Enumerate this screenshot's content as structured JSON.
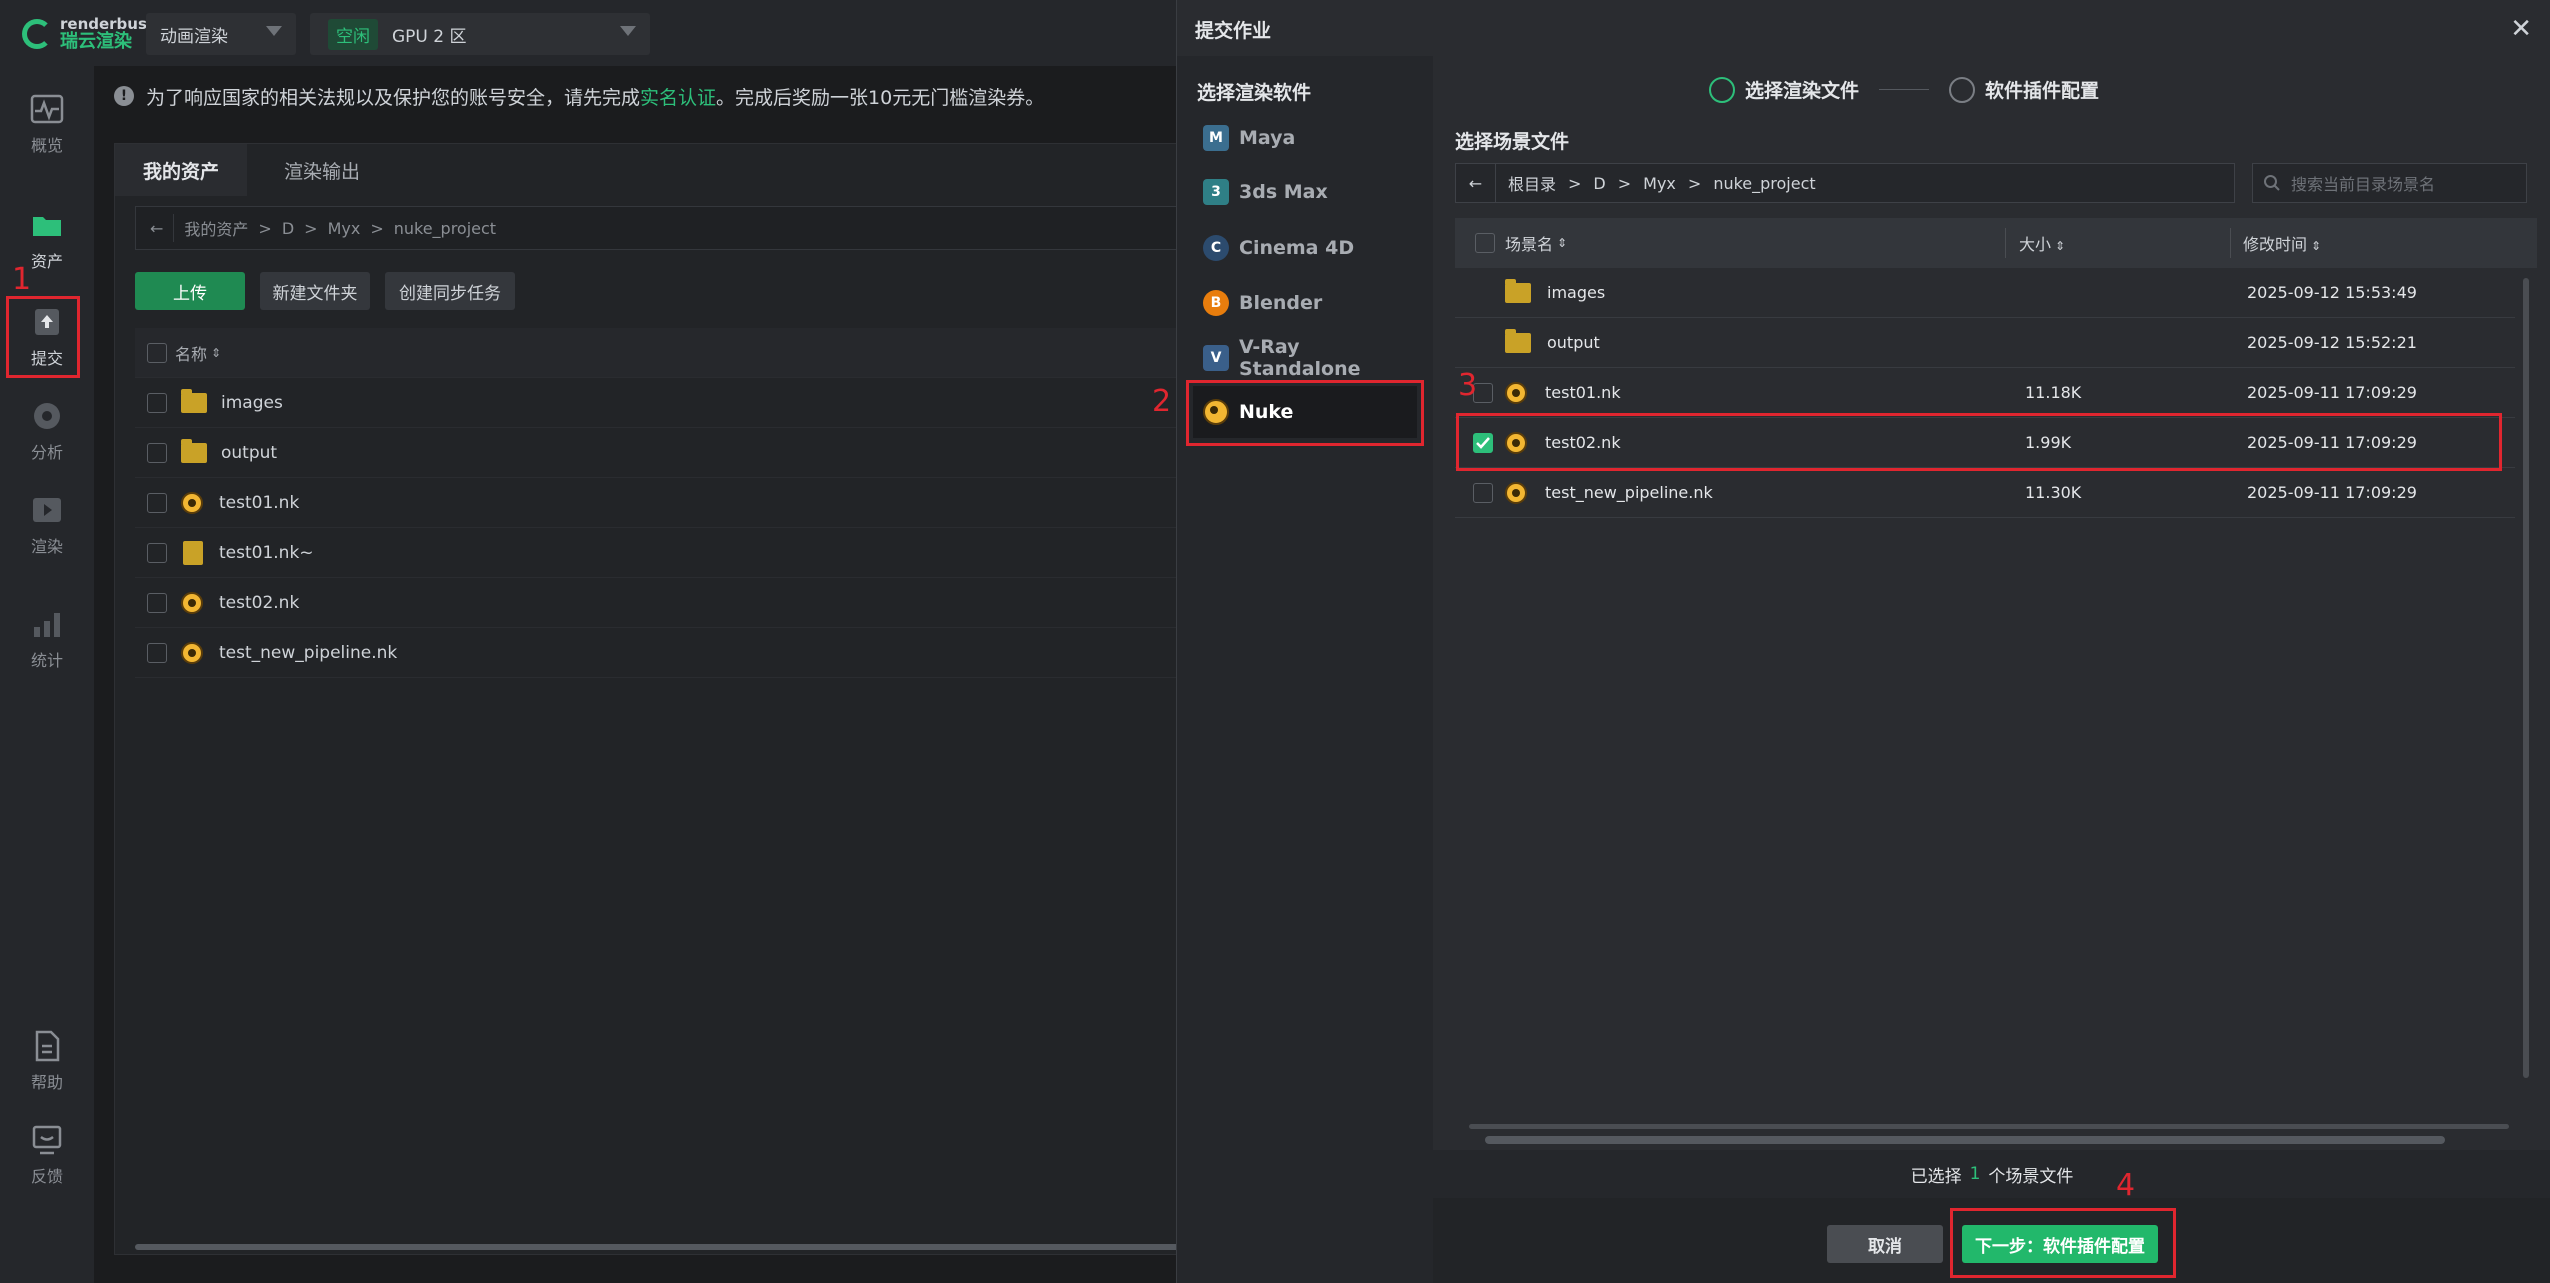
{
  "app": {
    "logo_brand": "renderbus",
    "logo_name": "瑞云渲染"
  },
  "topbar": {
    "mode_select": "动画渲染",
    "status_badge": "空闲",
    "gpu_select": "GPU 2 区"
  },
  "sidebar": {
    "items": [
      {
        "label": "概览",
        "icon": "pulse-icon"
      },
      {
        "label": "资产",
        "icon": "folder-icon"
      },
      {
        "label": "提交",
        "icon": "upload-icon"
      },
      {
        "label": "分析",
        "icon": "analysis-icon"
      },
      {
        "label": "渲染",
        "icon": "render-icon"
      },
      {
        "label": "统计",
        "icon": "bar-chart-icon"
      },
      {
        "label": "帮助",
        "icon": "doc-icon"
      },
      {
        "label": "反馈",
        "icon": "feedback-icon"
      }
    ]
  },
  "notice": {
    "prefix": "为了响应国家的相关法规以及保护您的账号安全，请先完成",
    "link": "实名认证",
    "suffix": "。完成后奖励一张10元无门槛渲染券。"
  },
  "assets": {
    "tabs": [
      "我的资产",
      "渲染输出"
    ],
    "path": [
      "我的资产",
      "D",
      "Myx",
      "nuke_project"
    ],
    "buttons": {
      "upload": "上传",
      "new_folder": "新建文件夹",
      "sync": "创建同步任务"
    },
    "col_name": "名称",
    "rows": [
      {
        "name": "images",
        "type": "folder"
      },
      {
        "name": "output",
        "type": "folder"
      },
      {
        "name": "test01.nk",
        "type": "nuke"
      },
      {
        "name": "test01.nk~",
        "type": "file"
      },
      {
        "name": "test02.nk",
        "type": "nuke"
      },
      {
        "name": "test_new_pipeline.nk",
        "type": "nuke"
      }
    ]
  },
  "dialog": {
    "title": "提交作业",
    "software_header": "选择渲染软件",
    "software": [
      "Maya",
      "3ds Max",
      "Cinema 4D",
      "Blender",
      "V-Ray Standalone",
      "Nuke"
    ],
    "step1": "选择渲染文件",
    "step2": "软件插件配置",
    "scene_header": "选择场景文件",
    "path": [
      "根目录",
      "D",
      "Myx",
      "nuke_project"
    ],
    "search_placeholder": "搜索当前目录场景名",
    "columns": {
      "name": "场景名",
      "size": "大小",
      "mtime": "修改时间"
    },
    "rows": [
      {
        "name": "images",
        "size": "",
        "mtime": "2025-09-12 15:53:49",
        "type": "folder",
        "checked": false
      },
      {
        "name": "output",
        "size": "",
        "mtime": "2025-09-12 15:52:21",
        "type": "folder",
        "checked": false
      },
      {
        "name": "test01.nk",
        "size": "11.18K",
        "mtime": "2025-09-11 17:09:29",
        "type": "nuke",
        "checked": false
      },
      {
        "name": "test02.nk",
        "size": "1.99K",
        "mtime": "2025-09-11 17:09:29",
        "type": "nuke",
        "checked": true
      },
      {
        "name": "test_new_pipeline.nk",
        "size": "11.30K",
        "mtime": "2025-09-11 17:09:29",
        "type": "nuke",
        "checked": false
      }
    ],
    "selected_prefix": "已选择",
    "selected_count": "1",
    "selected_suffix": "个场景文件",
    "cancel": "取消",
    "next": "下一步：软件插件配置"
  },
  "annotations": [
    "1",
    "2",
    "3",
    "4"
  ],
  "colors": {
    "accent": "#2dbf7a",
    "annotation": "#e0262f",
    "folder": "#c9a227",
    "nuke": "#f2b632"
  }
}
